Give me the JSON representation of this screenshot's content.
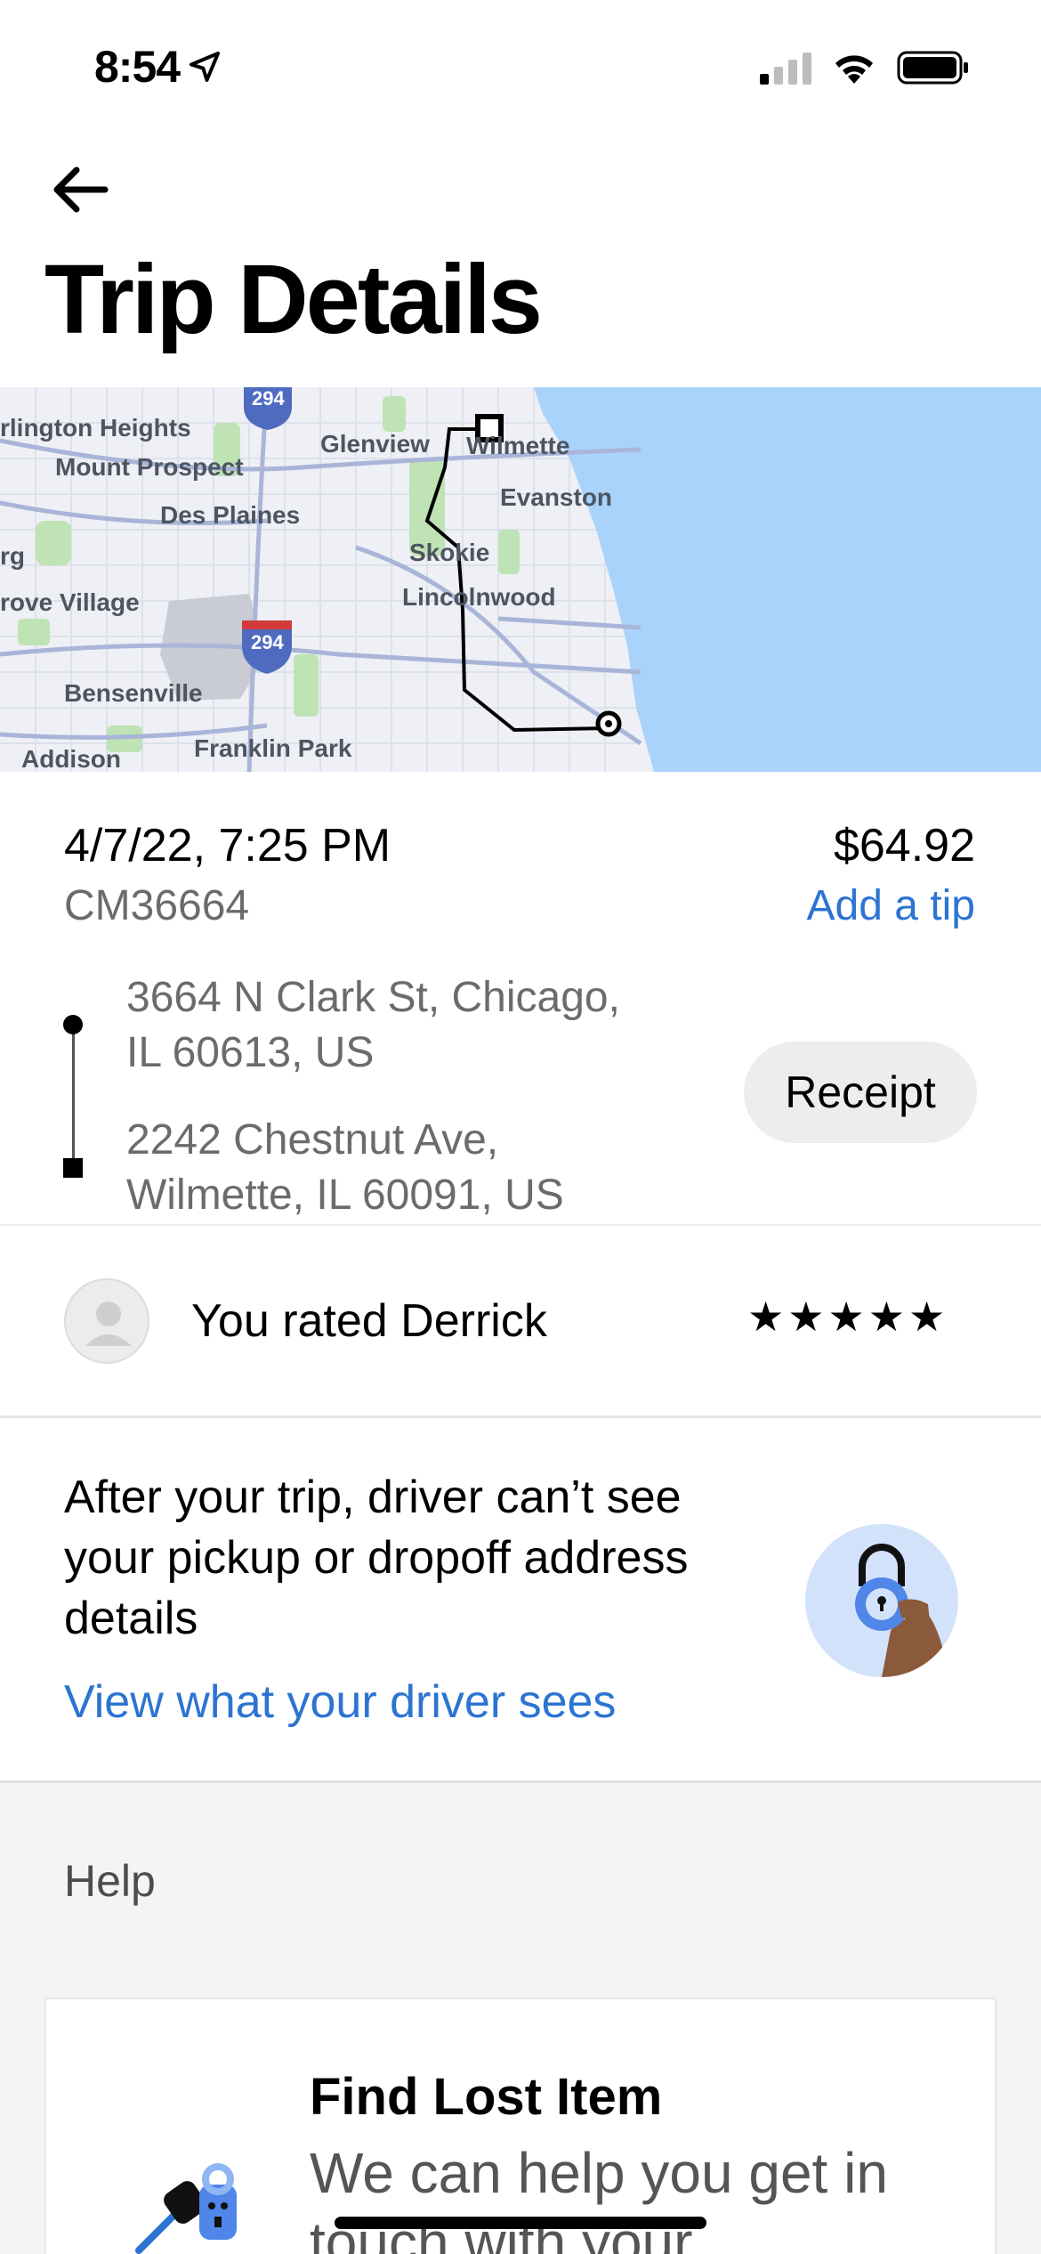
{
  "status_bar": {
    "time": "8:54",
    "location_icon": "location-arrow-icon",
    "signal_icon": "cellular-signal-icon",
    "wifi_icon": "wifi-icon",
    "battery_icon": "battery-icon"
  },
  "header": {
    "back_icon": "back-arrow-icon",
    "title": "Trip Details"
  },
  "map": {
    "labels": [
      "rlington Heights",
      "Mount Prospect",
      "Des Plaines",
      "rg",
      "rove Village",
      "Bensenville",
      "Addison",
      "Franklin Park",
      "Glenview",
      "Wilmette",
      "Evanston",
      "Skokie",
      "Lincolnwood"
    ],
    "highway_shields": [
      "294",
      "294"
    ]
  },
  "trip": {
    "datetime": "4/7/22, 7:25 PM",
    "id": "CM36664",
    "price": "$64.92",
    "add_tip": "Add a tip",
    "pickup_line1": "3664 N Clark St, Chicago,",
    "pickup_line2": "IL 60613, US",
    "dropoff_line1": "2242 Chestnut Ave,",
    "dropoff_line2": "Wilmette, IL 60091, US",
    "receipt_label": "Receipt"
  },
  "rating": {
    "text": "You rated Derrick",
    "stars": "★★★★★",
    "star_count": 5
  },
  "privacy": {
    "message": "After your trip, driver can’t see your pickup or dropoff address details",
    "link": "View what your driver sees"
  },
  "help": {
    "heading": "Help",
    "card_title": "Find Lost Item",
    "card_subtitle": "We can help you get in touch with your"
  },
  "colors": {
    "accent_link": "#2c74d1",
    "water": "#aad3fb",
    "receipt_bg": "#ededed",
    "help_bg": "#f4f4f4"
  }
}
